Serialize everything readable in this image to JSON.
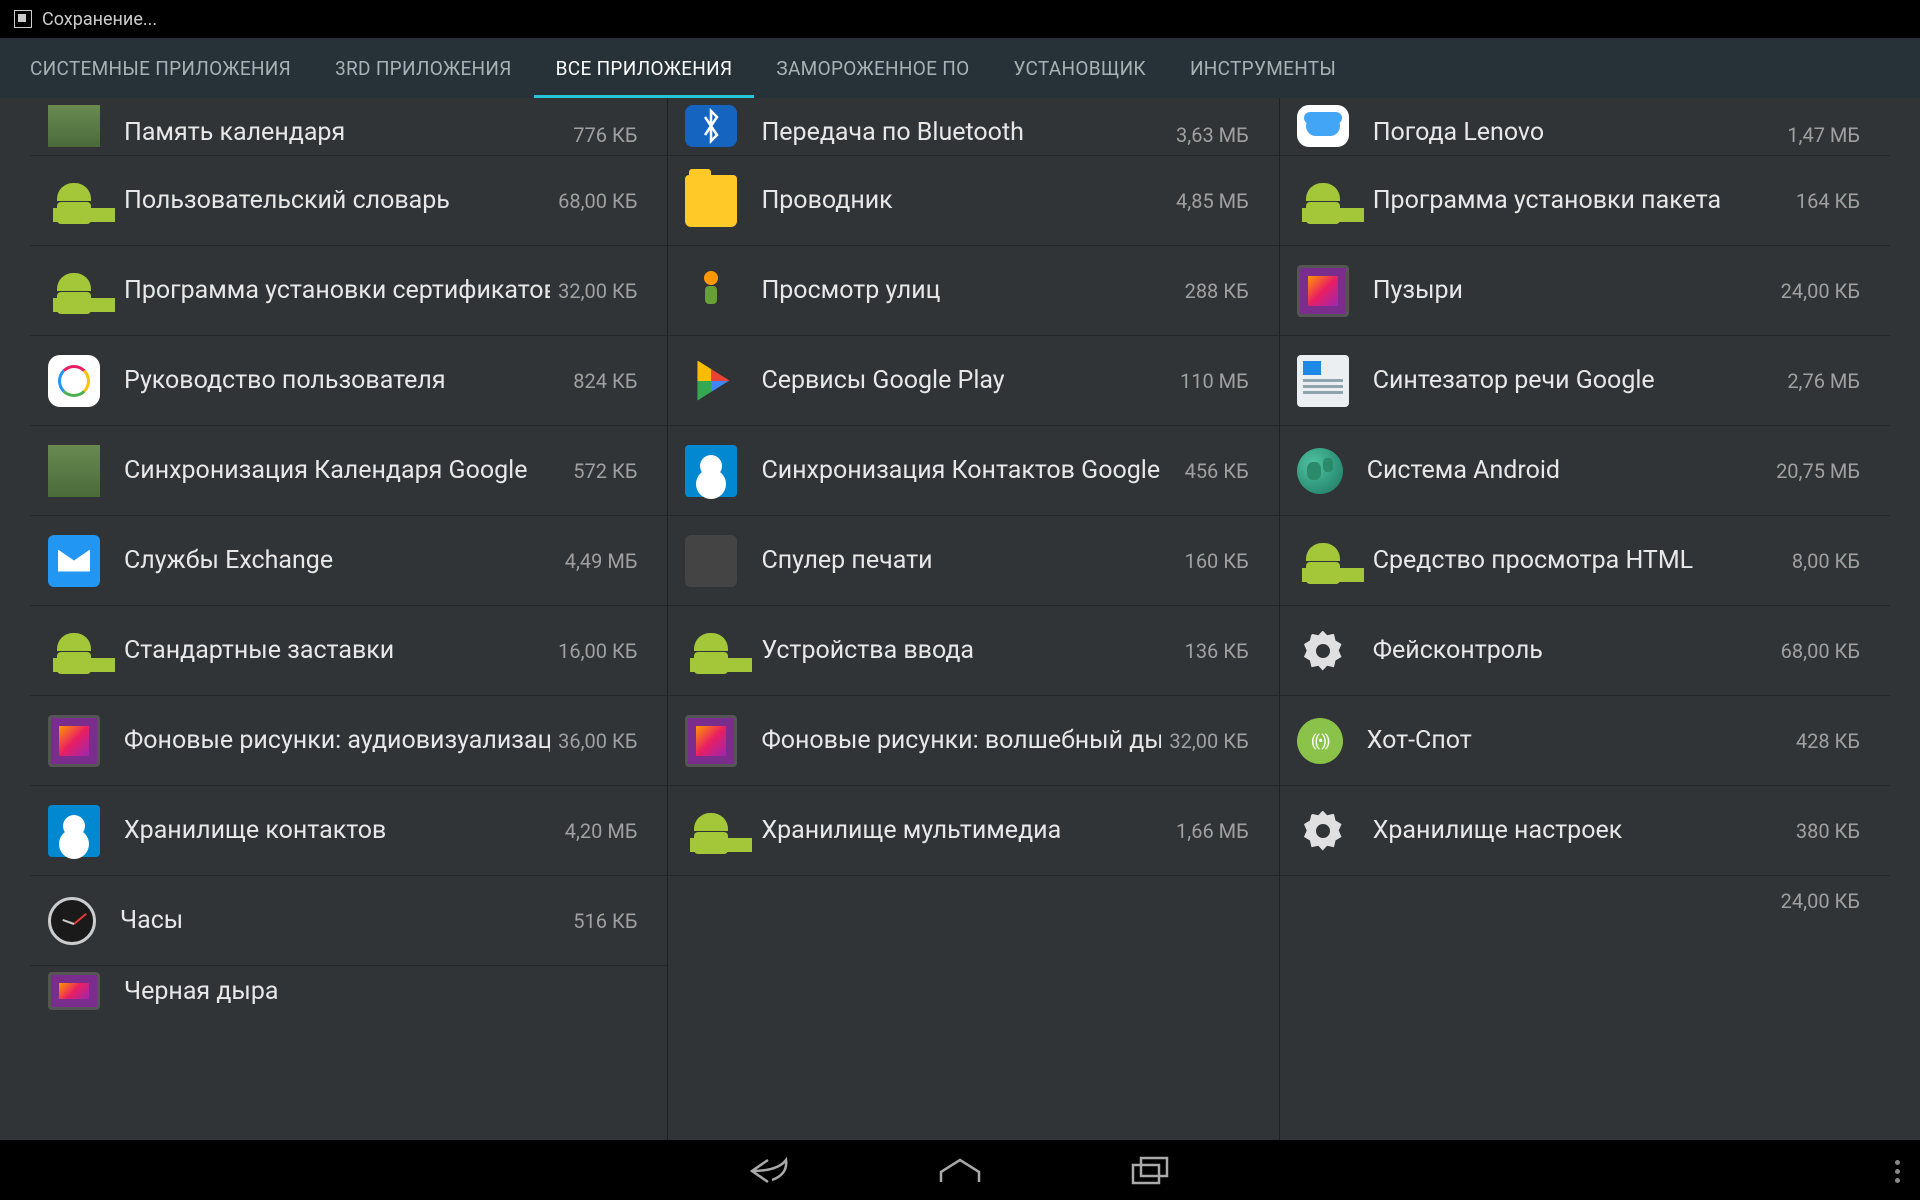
{
  "status": {
    "text": "Сохранение..."
  },
  "tabs": [
    {
      "label": "СИСТЕМНЫЕ ПРИЛОЖЕНИЯ",
      "active": false
    },
    {
      "label": "3RD ПРИЛОЖЕНИЯ",
      "active": false
    },
    {
      "label": "ВСЕ ПРИЛОЖЕНИЯ",
      "active": true
    },
    {
      "label": "ЗАМОРОЖЕННОЕ ПО",
      "active": false
    },
    {
      "label": "УСТАНОВЩИК",
      "active": false
    },
    {
      "label": "ИНСТРУМЕНТЫ",
      "active": false
    }
  ],
  "columns": [
    [
      {
        "name": "Память календаря",
        "size": "776 КБ",
        "icon": "calendar-storage",
        "peek": true
      },
      {
        "name": "Пользовательский словарь",
        "size": "68,00 КБ",
        "icon": "android"
      },
      {
        "name": "Программа установки сертификатов",
        "size": "32,00 КБ",
        "icon": "android"
      },
      {
        "name": "Руководство пользователя",
        "size": "824 КБ",
        "icon": "manual"
      },
      {
        "name": "Синхронизация Календаря Google",
        "size": "572 КБ",
        "icon": "calendar-sync"
      },
      {
        "name": "Службы Exchange",
        "size": "4,49 МБ",
        "icon": "exchange"
      },
      {
        "name": "Стандартные заставки",
        "size": "16,00 КБ",
        "icon": "android"
      },
      {
        "name": "Фоновые рисунки: аудиовизуализация",
        "size": "36,00 КБ",
        "icon": "wallpaper"
      },
      {
        "name": "Хранилище контактов",
        "size": "4,20 МБ",
        "icon": "contacts"
      },
      {
        "name": "Часы",
        "size": "516 КБ",
        "icon": "clock"
      },
      {
        "name": "Черная дыра",
        "size": "",
        "icon": "wallpaper",
        "peek2": true
      }
    ],
    [
      {
        "name": "Передача по Bluetooth",
        "size": "3,63 МБ",
        "icon": "bluetooth",
        "peek": true
      },
      {
        "name": "Проводник",
        "size": "4,85 МБ",
        "icon": "folder"
      },
      {
        "name": "Просмотр улиц",
        "size": "288 КБ",
        "icon": "streetview"
      },
      {
        "name": "Сервисы Google Play",
        "size": "110 МБ",
        "icon": "play"
      },
      {
        "name": "Синхронизация Контактов Google",
        "size": "456 КБ",
        "icon": "contacts-sync"
      },
      {
        "name": "Спулер печати",
        "size": "160 КБ",
        "icon": "blank"
      },
      {
        "name": "Устройства ввода",
        "size": "136 КБ",
        "icon": "android"
      },
      {
        "name": "Фоновые рисунки: волшебный дым",
        "size": "32,00 КБ",
        "icon": "wallpaper"
      },
      {
        "name": "Хранилище мультимедиа",
        "size": "1,66 МБ",
        "icon": "android"
      }
    ],
    [
      {
        "name": "Погода Lenovo",
        "size": "1,47 МБ",
        "icon": "weather",
        "peek": true
      },
      {
        "name": "Программа установки пакета",
        "size": "164 КБ",
        "icon": "android"
      },
      {
        "name": "Пузыри",
        "size": "24,00 КБ",
        "icon": "wallpaper"
      },
      {
        "name": "Синтезатор речи Google",
        "size": "2,76 МБ",
        "icon": "tts"
      },
      {
        "name": "Система Android",
        "size": "20,75 МБ",
        "icon": "system"
      },
      {
        "name": "Средство просмотра HTML",
        "size": "8,00 КБ",
        "icon": "android"
      },
      {
        "name": "Фейсконтроль",
        "size": "68,00 КБ",
        "icon": "gear"
      },
      {
        "name": "Хот-Спот",
        "size": "428 КБ",
        "icon": "hotspot"
      },
      {
        "name": "Хранилище настроек",
        "size": "380 КБ",
        "icon": "gear"
      },
      {
        "name": "",
        "size": "24,00 КБ",
        "icon": "none",
        "peek2": true
      }
    ]
  ]
}
